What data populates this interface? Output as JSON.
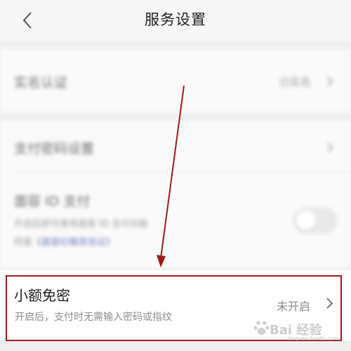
{
  "header": {
    "title": "服务设置",
    "back_icon": "chevron-left-icon"
  },
  "rows": {
    "realname": {
      "label": "实名认证",
      "value": "已实名"
    },
    "paypassword": {
      "label": "支付密码设置"
    },
    "faceid": {
      "label": "面容 ID 支付",
      "desc": "开启后即可使用面容 ID 支付功能",
      "link_prefix": "同意",
      "link": "《面容ID服务协议》",
      "toggle_on": false
    },
    "small_amount": {
      "label": "小额免密",
      "desc": "开启后，支付时无需输入密码或指纹",
      "status": "未开启"
    }
  },
  "watermark": {
    "text": "Bai 经验",
    "sub": "jingyan.baidu.com"
  },
  "colors": {
    "highlight": "#a11a1a",
    "background": "#efefef"
  }
}
